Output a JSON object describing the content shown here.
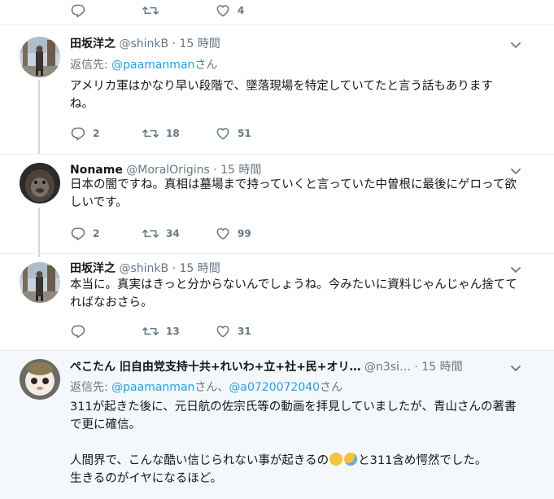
{
  "top_actions": {
    "reply": "",
    "retweet": "",
    "like": "4"
  },
  "tweets": [
    {
      "name": "田坂洋之",
      "handle": "@shinkB",
      "dot": "·",
      "time": "15 時間",
      "reply_prefix": "返信先: ",
      "reply_to": [
        "@paamanman"
      ],
      "reply_suffix": "さん",
      "text": "アメリカ軍はかなり早い段階で、墜落現場を特定していてたと言う話もありますね。",
      "replies": "2",
      "retweets": "18",
      "likes": "51"
    },
    {
      "name": "Noname",
      "handle": "@MoralOrigins",
      "dot": "·",
      "time": "15 時間",
      "text": "日本の闇ですね。真相は墓場まで持っていくと言っていた中曽根に最後にゲロって欲しいです。",
      "replies": "2",
      "retweets": "34",
      "likes": "99"
    },
    {
      "name": "田坂洋之",
      "handle": "@shinkB",
      "dot": "·",
      "time": "15 時間",
      "text": "本当に。真実はきっと分からないんでしょうね。今みたいに資料じゃんじゃん捨ててればなおさら。",
      "replies": "",
      "retweets": "13",
      "likes": "31"
    },
    {
      "name": "ぺこたん 旧自由党支持十共+れいわ+立+社+民+オリ…",
      "handle": "@n3si…",
      "dot": "·",
      "time": "15 時間",
      "reply_prefix": "返信先: ",
      "reply_to": [
        "@paamanman",
        "@a0720072040"
      ],
      "reply_mid": "さん、",
      "reply_suffix": "さん",
      "text_lines": [
        "311が起きた後に、元日航の佐宗氏等の動画を拝見していましたが、青山さんの著書で更に確信。",
        "",
        "人間界で、こんな酷い信じられない事が起きるの",
        "と311含め愕然でした。",
        "生きるのがイヤになるほど。"
      ]
    }
  ],
  "icons": {
    "reply": "reply-icon",
    "retweet": "retweet-icon",
    "like": "heart-icon",
    "caret": "chevron-down-icon"
  },
  "colors": {
    "link": "#1da1f2",
    "muted": "#657786",
    "thread": "#cdd8e0",
    "highlight": "#f5f8fa"
  }
}
